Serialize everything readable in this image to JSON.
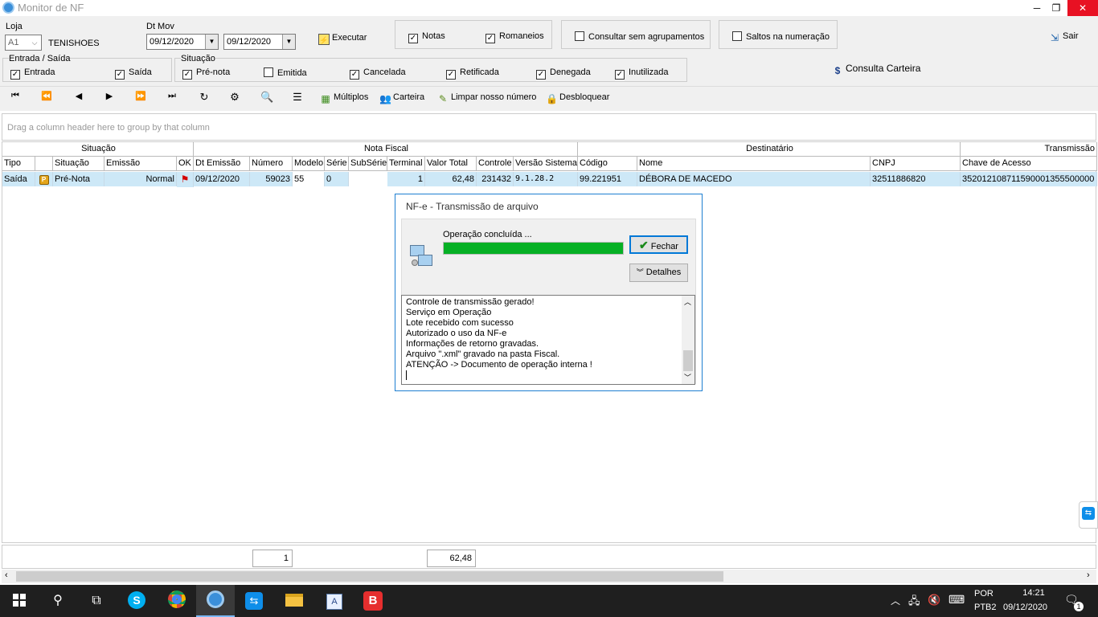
{
  "window": {
    "title": "Monitor de NF"
  },
  "filters": {
    "loja_label": "Loja",
    "loja_value": "A1",
    "loja_name": "TENISHOES",
    "dtmov_label": "Dt Mov",
    "date_from": "09/12/2020",
    "date_to": "09/12/2020",
    "executar": "Executar",
    "notas": "Notas",
    "romaneios": "Romaneios",
    "consultar_sem_agrupamentos": "Consultar sem agrupamentos",
    "saltos": "Saltos na numeração",
    "sair": "Sair",
    "entrada_saida_label": "Entrada / Saída",
    "entrada": "Entrada",
    "saida": "Saída",
    "situacao_label": "Situação",
    "pre_nota": "Pré-nota",
    "emitida": "Emitida",
    "cancelada": "Cancelada",
    "retificada": "Retificada",
    "denegada": "Denegada",
    "inutilizada": "Inutilizada",
    "consulta_carteira": "Consulta Carteira"
  },
  "toolbar": {
    "multiplos": "Múltiplos",
    "carteira": "Carteira",
    "limpar": "Limpar nosso número",
    "desbloquear": "Desbloquear"
  },
  "grid": {
    "group_hint": "Drag a column header here to group by that column",
    "bands": {
      "situacao": "Situação",
      "nota_fiscal": "Nota Fiscal",
      "destinatario": "Destinatário",
      "transmissao": "Transmissão"
    },
    "columns": {
      "tipo": "Tipo",
      "situacao": "Situação",
      "emissao": "Emissão",
      "ok": "OK",
      "dt_emissao": "Dt Emissão",
      "numero": "Número",
      "modelo": "Modelo",
      "serie": "Série",
      "subserie": "SubSérie",
      "terminal": "Terminal",
      "valor_total": "Valor Total",
      "controle": "Controle",
      "versao": "Versão Sistema",
      "codigo": "Código",
      "nome": "Nome",
      "cnpj": "CNPJ",
      "chave": "Chave de Acesso"
    },
    "row": {
      "tipo": "Saída",
      "situacao": "Pré-Nota",
      "emissao": "Normal",
      "dt_emissao": "09/12/2020",
      "numero": "59023",
      "modelo": "55",
      "serie": "0",
      "subserie": "",
      "terminal": "1",
      "valor_total": "62,48",
      "controle": "231432",
      "versao": "9.1.28.2",
      "codigo": "99.221951",
      "nome": "DÉBORA DE MACEDO",
      "cnpj": "32511886820",
      "chave": "352012108711590001355500000"
    },
    "footer": {
      "count": "1",
      "total": "62,48"
    }
  },
  "dialog": {
    "title": "NF-e - Transmissão de arquivo",
    "status": "Operação concluída ...",
    "progress": 1.0,
    "fechar": "Fechar",
    "detalhes": "Detalhes",
    "log": [
      "Controle de transmissão gerado!",
      "Serviço em Operação",
      "Lote recebido com sucesso",
      "Autorizado o uso da NF-e",
      "Informações de retorno gravadas.",
      "Arquivo \".xml\" gravado na pasta Fiscal.",
      "ATENÇÃO -> Documento de operação interna !"
    ]
  },
  "taskbar": {
    "lang1": "POR",
    "lang2": "PTB2",
    "time": "14:21",
    "date": "09/12/2020",
    "notif_count": "1"
  },
  "colors": {
    "accent": "#1e7fd1",
    "progress": "#06b025",
    "row_select": "#cde8f7",
    "close": "#e81123"
  }
}
